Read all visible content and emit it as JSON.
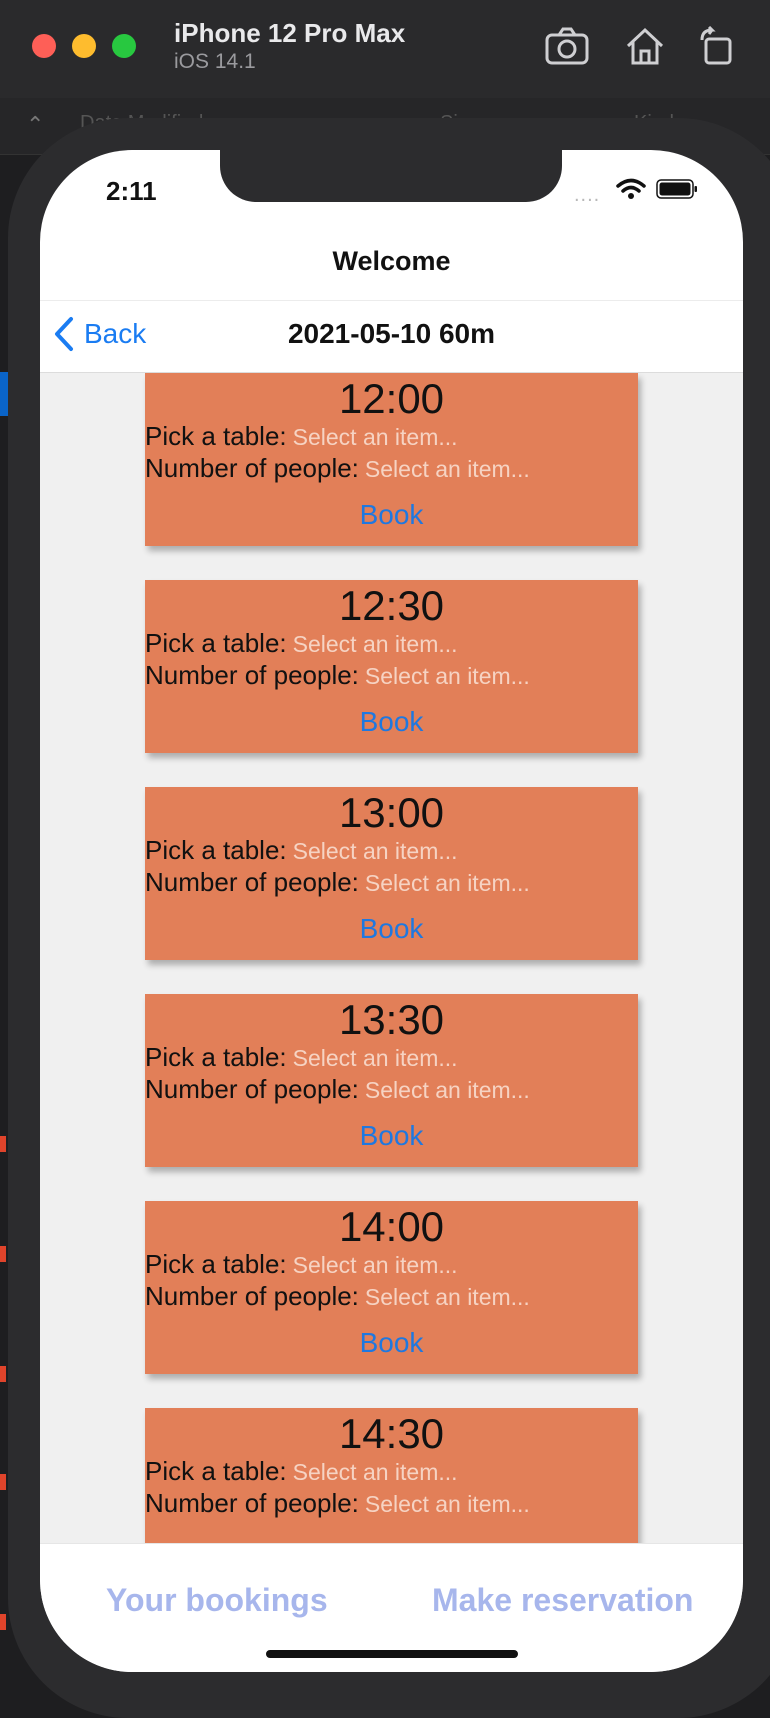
{
  "simulator": {
    "device_name": "iPhone 12 Pro Max",
    "os_version": "iOS 14.1",
    "icons": [
      "screenshot-icon",
      "home-icon",
      "rotate-icon"
    ]
  },
  "background_columns": {
    "date_modified": "Date Modified",
    "size": "Size",
    "kind": "Kind"
  },
  "status_bar": {
    "time": "2:11",
    "signal": "....",
    "wifi_icon": "wifi-icon",
    "battery_icon": "battery-icon"
  },
  "nav": {
    "welcome": "Welcome",
    "back_label": "Back",
    "title": "2021-05-10 60m"
  },
  "slots": [
    {
      "time": "12:00",
      "table_label": "Pick a table:",
      "table_placeholder": "Select an item...",
      "people_label": "Number of people:",
      "people_placeholder": "Select an item...",
      "book_label": "Book"
    },
    {
      "time": "12:30",
      "table_label": "Pick a table:",
      "table_placeholder": "Select an item...",
      "people_label": "Number of people:",
      "people_placeholder": "Select an item...",
      "book_label": "Book"
    },
    {
      "time": "13:00",
      "table_label": "Pick a table:",
      "table_placeholder": "Select an item...",
      "people_label": "Number of people:",
      "people_placeholder": "Select an item...",
      "book_label": "Book"
    },
    {
      "time": "13:30",
      "table_label": "Pick a table:",
      "table_placeholder": "Select an item...",
      "people_label": "Number of people:",
      "people_placeholder": "Select an item...",
      "book_label": "Book"
    },
    {
      "time": "14:00",
      "table_label": "Pick a table:",
      "table_placeholder": "Select an item...",
      "people_label": "Number of people:",
      "people_placeholder": "Select an item...",
      "book_label": "Book"
    },
    {
      "time": "14:30",
      "table_label": "Pick a table:",
      "table_placeholder": "Select an item...",
      "people_label": "Number of people:",
      "people_placeholder": "Select an item..."
    }
  ],
  "tabs": {
    "bookings": "Your bookings",
    "reserve": "Make reservation"
  },
  "colors": {
    "card": "#e27f58",
    "accent": "#1a7cf2",
    "tab_inactive": "#a7b6ec",
    "content_bg": "#f0f0f0"
  }
}
